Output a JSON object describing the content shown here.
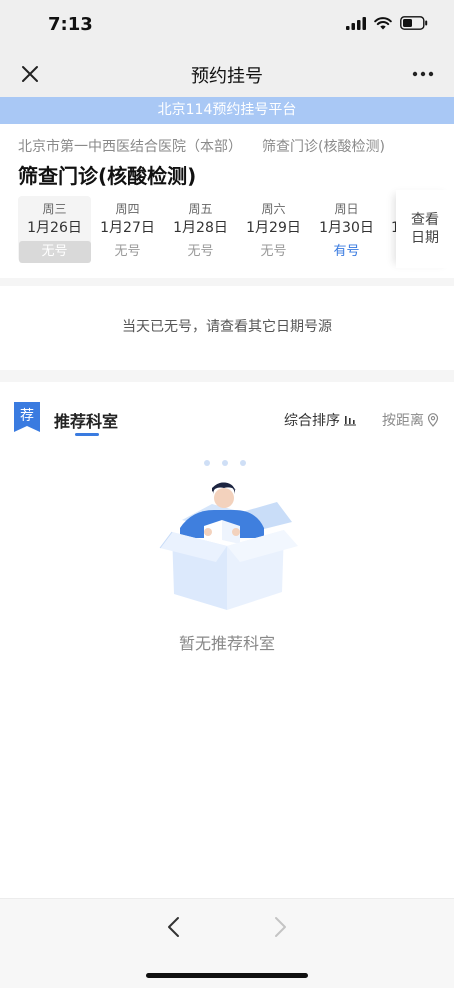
{
  "status_bar": {
    "time": "7:13"
  },
  "nav": {
    "title": "预约挂号"
  },
  "banner": {
    "text": "北京114预约挂号平台"
  },
  "hospital": {
    "name": "北京市第一中西医结合医院（本部）",
    "clinic": "筛查门诊(核酸检测)",
    "page_title": "筛查门诊(核酸检测)"
  },
  "dates": [
    {
      "weekday": "周三",
      "day": "1月26日",
      "status": "无号",
      "selected": true
    },
    {
      "weekday": "周四",
      "day": "1月27日",
      "status": "无号",
      "selected": false
    },
    {
      "weekday": "周五",
      "day": "1月28日",
      "status": "无号",
      "selected": false
    },
    {
      "weekday": "周六",
      "day": "1月29日",
      "status": "无号",
      "selected": false
    },
    {
      "weekday": "周日",
      "day": "1月30日",
      "status": "有号",
      "selected": false
    }
  ],
  "dates_overflow_digit": "1",
  "view_dates_label": "查看日期",
  "no_slot_message": "当天已无号，请查看其它日期号源",
  "recommend": {
    "badge_char": "荐",
    "title": "推荐科室",
    "sort_combined": "综合排序",
    "sort_distance": "按距离",
    "empty_text": "暂无推荐科室"
  },
  "colors": {
    "accent": "#3a7be0",
    "banner": "#a9c8f5"
  },
  "icons": {
    "close": "close-icon",
    "more": "more-icon",
    "back": "chevron-left-icon",
    "forward": "chevron-right-icon",
    "location": "location-icon",
    "sort": "sort-bars-icon"
  }
}
